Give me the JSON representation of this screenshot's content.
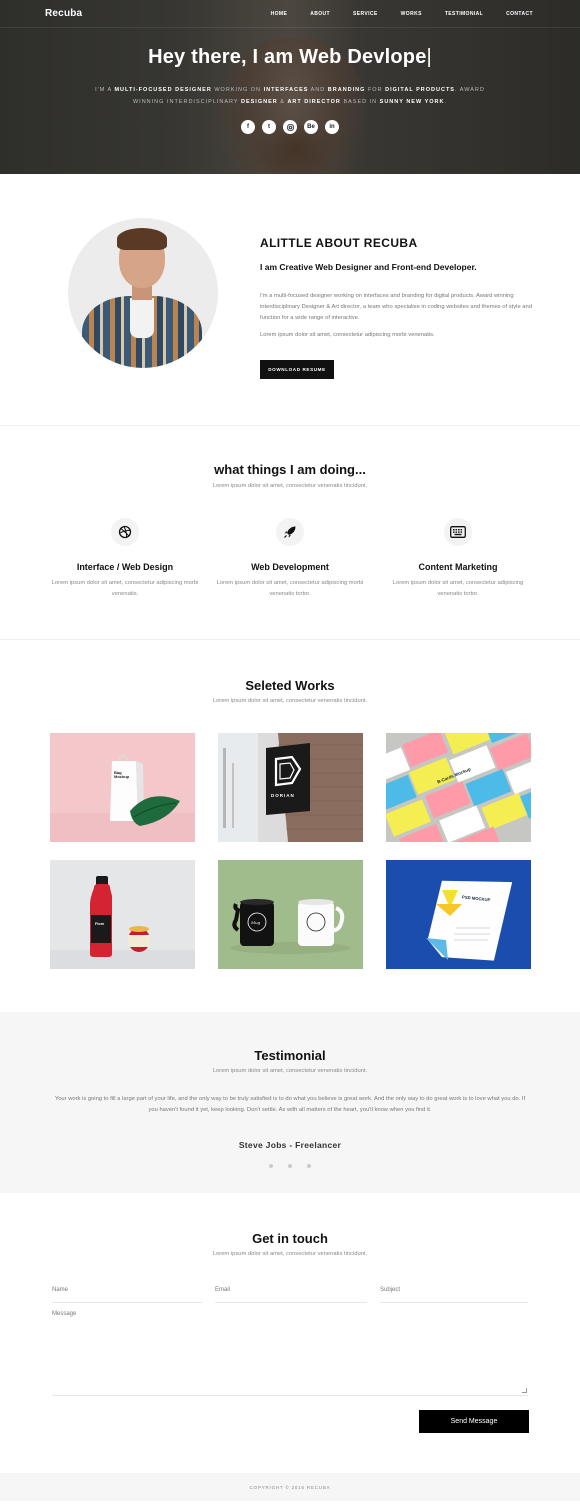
{
  "nav": {
    "logo": "Recuba",
    "items": [
      "HOME",
      "ABOUT",
      "SERVICE",
      "WORKS",
      "TESTIMONIAL",
      "CONTACT"
    ]
  },
  "hero": {
    "heading": "Hey there, I am Web Devlope",
    "cursor": "|",
    "line1": {
      "a": "I'M A ",
      "b": "MULTI-FOCUSED DESIGNER",
      "c": " WORKING ON ",
      "d": "INTERFACES",
      "e": " AND ",
      "f": "BRANDING",
      "g": " FOR ",
      "h": "DIGITAL PRODUCTS",
      "i": ". AWARD"
    },
    "line2": {
      "a": "WINNING INTERDISCIPLINARY ",
      "b": "DESIGNER",
      "c": " & ",
      "d": "ART DIRECTOR",
      "e": " BASED IN ",
      "f": "SUNNY NEW YORK",
      "g": "."
    },
    "socials": [
      "f",
      "t",
      "o",
      "Be",
      "in"
    ]
  },
  "about": {
    "title": "ALITTLE ABOUT RECUBA",
    "subtitle": "I am Creative Web Designer and Front-end Developer.",
    "para1": "I'm a multi-focused designer working on interfaces and branding for digital products. Award winning interdisciplinary Designer & Art director, a team who specialise in coding websites and themes of style and function for a wide range of interactive.",
    "para2": "Lorem ipsum dolor sit amet, consectetur adipiscing morbi venenatis.",
    "button": "DOWNLOAD RESUME"
  },
  "services": {
    "title": "what things I am doing...",
    "subtitle": "Lorem ipsum dolor sit amet, consectetur venenatis tincidunt.",
    "items": [
      {
        "icon": "dribbble-icon",
        "title": "Interface / Web Design",
        "text": "Lorem ipsum dolor sit amet, consectetur adipiscing morbi venenatis."
      },
      {
        "icon": "rocket-icon",
        "title": "Web Development",
        "text": "Lorem ipsum dolor sit amet, consectetur adipiscing morbi venenatis tortor."
      },
      {
        "icon": "keyboard-icon",
        "title": "Content Marketing",
        "text": "Lorem ipsum dolor sit amet, consectetur adipiscing venenatis tortor."
      }
    ]
  },
  "works": {
    "title": "Seleted Works",
    "subtitle": "Lorem ipsum dolor sit amet, consectetur venenatis tincidunt.",
    "tiles": {
      "bag_text": "Bag Mockup",
      "sign_text": "DORIAN",
      "cards_text": "B-Cards Mockup",
      "jar_text": "Fiore",
      "mug_text": "Mug",
      "letter_text": "PSD MOCKUP"
    }
  },
  "testimonial": {
    "title": "Testimonial",
    "subtitle": "Lorem ipsum dolor sit amet, consectetur venenatis tincidunt.",
    "quote": "Your work is going to fill a large part of your life, and the only way to be truly satisfied is to do what you believe is great work. And the only way to do great work is to love what you do. If you haven't found it yet, keep looking. Don't settle. As with all matters of the heart, you'll know when you find it.",
    "author": "Steve Jobs - Freelancer"
  },
  "contact": {
    "title": "Get in touch",
    "subtitle": "Lorem ipsum dolor sit amet, consectetur venenatis tincidunt.",
    "name_placeholder": "Name",
    "email_placeholder": "Email",
    "subject_placeholder": "Subject",
    "message_placeholder": "Message",
    "button": "Send Message"
  },
  "footer": {
    "text": "COPYRIGHT © 2016 RECUBA"
  },
  "colors": {
    "accent": "#000000",
    "pink": "#f5c9cc",
    "blue": "#1e4fb0",
    "green": "#9fb984"
  }
}
